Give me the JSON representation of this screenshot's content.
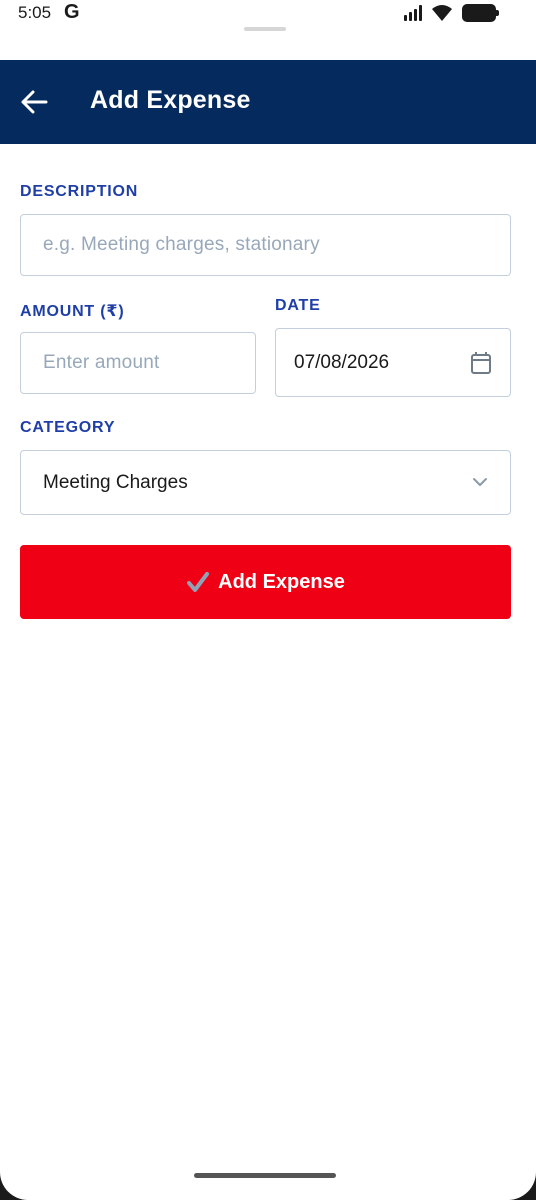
{
  "status_bar": {
    "time": "5:05",
    "google_badge": "G",
    "icons": [
      "signal-icon",
      "wifi-icon",
      "battery-icon"
    ]
  },
  "app_bar": {
    "title": "Add Expense",
    "back_icon": "arrow-left-icon",
    "background": "#042a5e"
  },
  "form": {
    "description": {
      "label": "DESCRIPTION",
      "placeholder": "e.g. Meeting charges, stationary",
      "value": ""
    },
    "amount": {
      "label": "AMOUNT (₹)",
      "placeholder": "Enter amount",
      "value": ""
    },
    "date": {
      "label": "DATE",
      "value": "07/08/2026",
      "icon": "calendar-icon"
    },
    "category": {
      "label": "CATEGORY",
      "selected": "Meeting Charges",
      "icon": "chevron-down-icon"
    },
    "submit": {
      "label": "Add Expense",
      "icon": "check-icon",
      "color": "#f00014"
    }
  },
  "colors": {
    "label": "#1f3fa6",
    "border": "#c3cfdc",
    "placeholder": "#98a8ba"
  }
}
